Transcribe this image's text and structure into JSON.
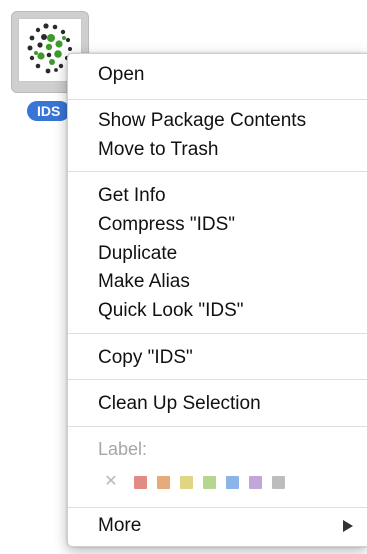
{
  "desktop_item": {
    "name": "IDS",
    "icon": "molecule-dots-package-icon",
    "selection_color": "#3875d7"
  },
  "context_menu": {
    "groups": [
      [
        "Open"
      ],
      [
        "Show Package Contents",
        "Move to Trash"
      ],
      [
        "Get Info",
        "Compress \"IDS\"",
        "Duplicate",
        "Make Alias",
        "Quick Look \"IDS\""
      ],
      [
        "Copy \"IDS\""
      ],
      [
        "Clean Up Selection"
      ]
    ],
    "label_heading": "Label:",
    "label_colors": [
      {
        "name": "red",
        "color": "#e38a86"
      },
      {
        "name": "orange",
        "color": "#e6ab78"
      },
      {
        "name": "yellow",
        "color": "#dfd683"
      },
      {
        "name": "green",
        "color": "#b5d690"
      },
      {
        "name": "blue",
        "color": "#8bb4ea"
      },
      {
        "name": "purple",
        "color": "#c3a6d9"
      },
      {
        "name": "gray",
        "color": "#bdbdbd"
      }
    ],
    "label_none_icon": "x-icon",
    "more_label": "More",
    "more_icon": "triangle-right-icon"
  }
}
